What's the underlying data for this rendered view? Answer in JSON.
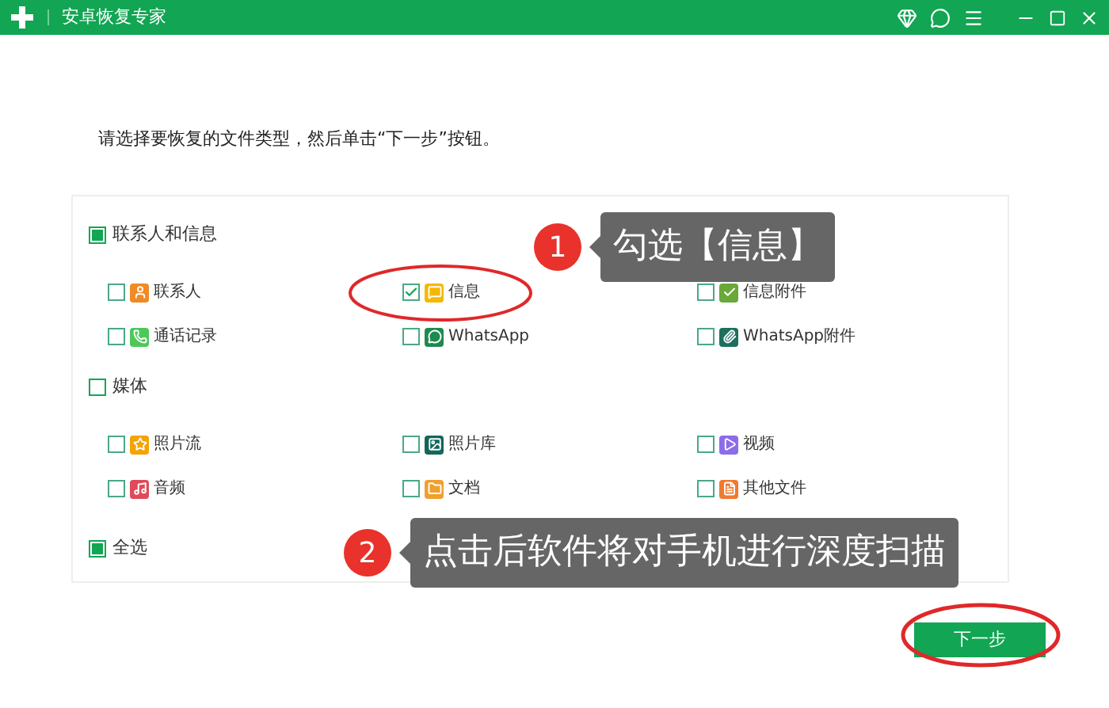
{
  "window": {
    "title": "安卓恢复专家"
  },
  "instruction": "请选择要恢复的文件类型，然后单击“下一步”按钮。",
  "groups": [
    {
      "label": "联系人和信息",
      "indeterminate": true,
      "items": [
        {
          "label": "联系人",
          "checked": false
        },
        {
          "label": "信息",
          "checked": true
        },
        {
          "label": "信息附件",
          "checked": false
        },
        {
          "label": "通话记录",
          "checked": false
        },
        {
          "label": "WhatsApp",
          "checked": false
        },
        {
          "label": "WhatsApp附件",
          "checked": false
        }
      ]
    },
    {
      "label": "媒体",
      "indeterminate": false,
      "items": [
        {
          "label": "照片流",
          "checked": false
        },
        {
          "label": "照片库",
          "checked": false
        },
        {
          "label": "视频",
          "checked": false
        },
        {
          "label": "音频",
          "checked": false
        },
        {
          "label": "文档",
          "checked": false
        },
        {
          "label": "其他文件",
          "checked": false
        }
      ]
    }
  ],
  "select_all": {
    "label": "全选",
    "indeterminate": true
  },
  "next_button": "下一步",
  "callouts": [
    {
      "number": "1",
      "text": "勾选【信息】"
    },
    {
      "number": "2",
      "text": "点击后软件将对手机进行深度扫描"
    }
  ]
}
